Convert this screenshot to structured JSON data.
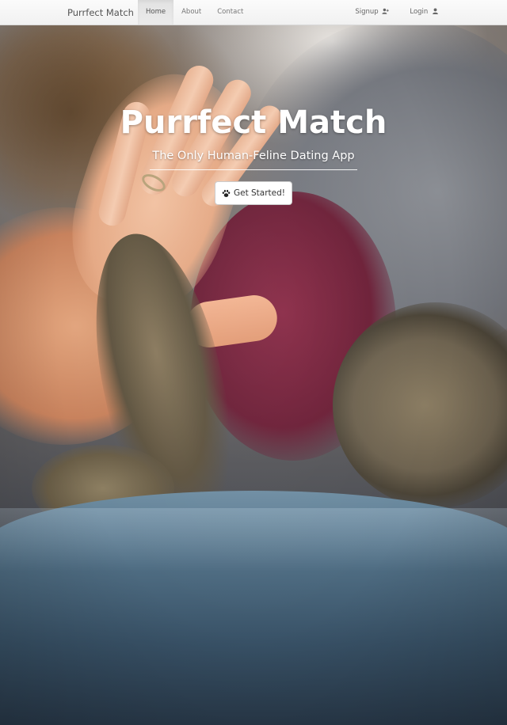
{
  "navbar": {
    "brand": "Purrfect Match",
    "links": [
      {
        "label": "Home",
        "active": true
      },
      {
        "label": "About",
        "active": false
      },
      {
        "label": "Contact",
        "active": false
      }
    ],
    "right_links": [
      {
        "label": "Signup",
        "icon": "user-plus-icon"
      },
      {
        "label": "Login",
        "icon": "user-icon"
      }
    ]
  },
  "hero": {
    "title": "Purrfect Match",
    "subtitle": "The Only Human-Feline Dating App",
    "cta_label": "Get Started!",
    "cta_icon": "paw-icon",
    "image_description_icon": "cat-high-five-photo"
  },
  "colors": {
    "navbar_bg": "#f8f8f8",
    "active_link_bg": "#e7e7e7",
    "hero_text": "#ffffff",
    "cta_bg": "#ffffff"
  }
}
